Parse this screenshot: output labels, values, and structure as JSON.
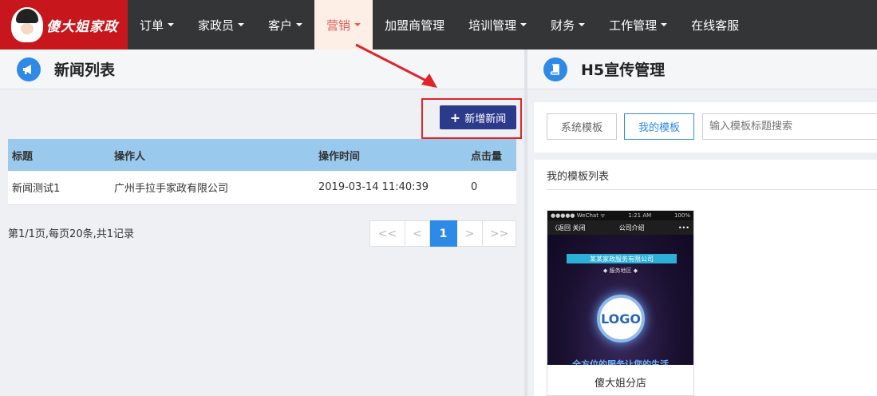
{
  "nav": {
    "brand": "傻大姐家政",
    "items": [
      {
        "label": "订单",
        "caret": true
      },
      {
        "label": "家政员",
        "caret": true
      },
      {
        "label": "客户",
        "caret": true
      },
      {
        "label": "营销",
        "caret": true,
        "active": true
      },
      {
        "label": "加盟商管理",
        "caret": false
      },
      {
        "label": "培训管理",
        "caret": true
      },
      {
        "label": "财务",
        "caret": true
      },
      {
        "label": "工作管理",
        "caret": true
      },
      {
        "label": "在线客服",
        "caret": false
      }
    ]
  },
  "news": {
    "title": "新闻列表",
    "add_label": "新增新闻",
    "columns": [
      "标题",
      "操作人",
      "操作时间",
      "点击量"
    ],
    "rows": [
      [
        "新闻测试1",
        "广州手拉手家政有限公司",
        "2019-03-14 11:40:39",
        "0"
      ]
    ],
    "page_info": "第1/1页,每页20条,共1记录",
    "pager": [
      "<<",
      "<",
      "1",
      ">",
      ">>"
    ],
    "current_page": "1"
  },
  "h5": {
    "title": "H5宣传管理",
    "tab_system": "系统模板",
    "tab_mine": "我的模板",
    "search_placeholder": "输入模板标题搜索",
    "list_title": "我的模板列表",
    "card": {
      "status_left": "●●●●● WeChat ᯤ",
      "status_time": "1:21 AM",
      "status_right": "100%",
      "back_label": "〈返回  关闭",
      "page_title": "公司介绍",
      "more": "•••",
      "company": "某某家政服务有限公司",
      "service_area": "服务地区",
      "logo": "LOGO",
      "slogan": "全方位的服务让您的生活",
      "name": "傻大姐分店"
    }
  },
  "colors": {
    "nav_bg": "#333537",
    "logo_bg": "#c8161d",
    "active_nav_bg": "#fdeee6",
    "active_nav_text": "#e0605a",
    "primary": "#2e8ae6",
    "add_button": "#2c3a8c",
    "table_header": "#99c9ed",
    "highlight_frame": "#e0242a"
  }
}
